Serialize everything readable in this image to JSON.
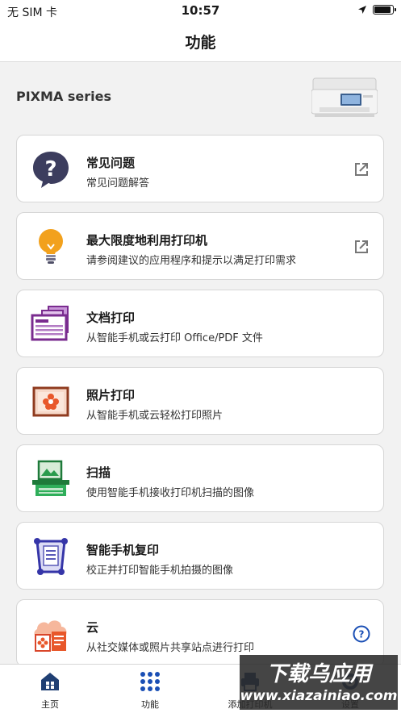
{
  "status": {
    "carrier": "无 SIM 卡",
    "time": "10:57",
    "battery_level": 0.9
  },
  "nav": {
    "title": "功能"
  },
  "printer": {
    "name": "PIXMA series",
    "image": "printer-image"
  },
  "cards": [
    {
      "title": "常见问题",
      "subtitle": "常见问题解答",
      "icon": "question-bubble-icon",
      "trail": "external-link-icon"
    },
    {
      "title": "最大限度地利用打印机",
      "subtitle": "请参阅建议的应用程序和提示以满足打印需求",
      "icon": "lightbulb-icon",
      "trail": "external-link-icon"
    },
    {
      "title": "文档打印",
      "subtitle": "从智能手机或云打印 Office/PDF 文件",
      "icon": "document-print-icon"
    },
    {
      "title": "照片打印",
      "subtitle": "从智能手机或云轻松打印照片",
      "icon": "photo-print-icon"
    },
    {
      "title": "扫描",
      "subtitle": "使用智能手机接收打印机扫描的图像",
      "icon": "scan-icon"
    },
    {
      "title": "智能手机复印",
      "subtitle": "校正并打印智能手机拍摄的图像",
      "icon": "smartphone-copy-icon"
    },
    {
      "title": "云",
      "subtitle": "从社交媒体或照片共享站点进行打印",
      "icon": "cloud-print-icon",
      "trail": "help-circle-icon"
    }
  ],
  "tabs": [
    {
      "label": "主页",
      "icon": "home-icon"
    },
    {
      "label": "功能",
      "icon": "grid-dots-icon",
      "active": true
    },
    {
      "label": "添加打印机",
      "icon": "add-printer-icon"
    },
    {
      "label": "设置",
      "icon": "settings-icon"
    }
  ],
  "watermark": {
    "text_cn": "下载乌应用",
    "text_url": "www.xiazainiao.com"
  },
  "colors": {
    "accent": "#1a4fb5",
    "card_border": "#d6d6d6",
    "background": "#f2f2f2"
  }
}
